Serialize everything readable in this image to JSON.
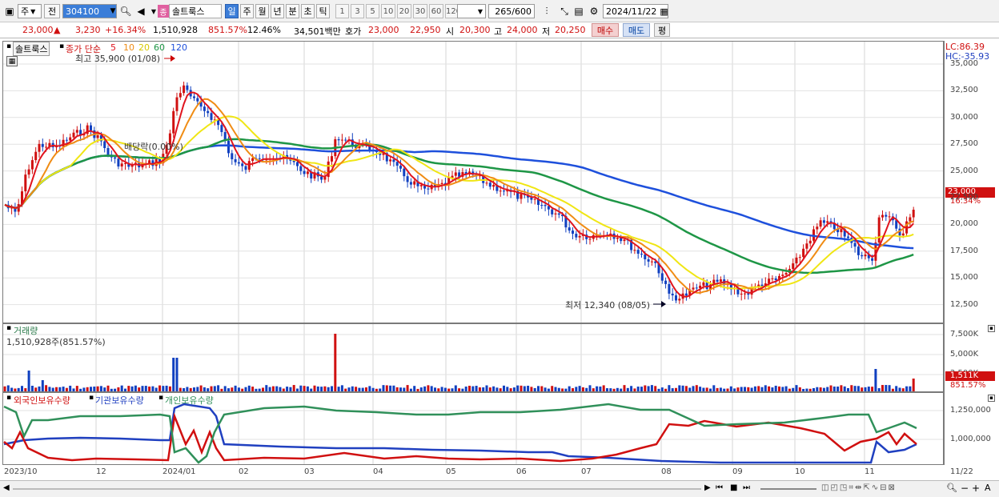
{
  "toolbar": {
    "market": "주",
    "prev": "전",
    "code": "304100",
    "badge": "종",
    "name": "솔트룩스",
    "periods": [
      "일",
      "주",
      "월",
      "년",
      "분",
      "초",
      "틱"
    ],
    "nums": [
      "1",
      "3",
      "5",
      "10",
      "20",
      "30",
      "60",
      "120"
    ],
    "count": "265",
    "count_total": "/600",
    "date": "2024/11/22"
  },
  "quote": {
    "price": "23,000",
    "arrow": "▲",
    "change": "3,230",
    "pct": "+16.34%",
    "volume": "1,510,928",
    "vol_ratio": "851.57%",
    "turnover": "12.46%",
    "amount": "34,501백만",
    "ask_label": "호가",
    "ask": "23,000",
    "bid": "22,950",
    "open_label": "시",
    "open": "20,300",
    "high_label": "고",
    "high": "24,000",
    "low_label": "저",
    "low": "20,250",
    "buy": "매수",
    "sell": "매도",
    "eval": "평"
  },
  "price_panel": {
    "name": "솔트룩스",
    "legend_prefix": "종가 단순",
    "ma": [
      {
        "label": "5",
        "color": "#e0141e"
      },
      {
        "label": "10",
        "color": "#f08c14"
      },
      {
        "label": "20",
        "color": "#f0e614"
      },
      {
        "label": "60",
        "color": "#1e9646"
      },
      {
        "label": "120",
        "color": "#1e50dc"
      }
    ],
    "high_note": "최고 35,900 (01/08)",
    "low_note": "최저 12,340 (08/05)",
    "dividend_note": "배당락(0.00%)",
    "lc": "LC:86.39",
    "hc": "HC:-35.93",
    "last_price": "23,000",
    "last_pct": "16.34%",
    "y_labels": [
      "35,000",
      "32,500",
      "30,000",
      "27,500",
      "25,000",
      "22,500",
      "20,000",
      "17,500",
      "15,000",
      "12,500"
    ]
  },
  "volume_panel": {
    "title": "거래량",
    "value": "1,510,928주(851.57%)",
    "y_labels": [
      "7,500K",
      "5,000K",
      "2,500K"
    ],
    "last": "1,511K",
    "last_pct": "851.57%"
  },
  "holders_panel": {
    "legend": [
      {
        "label": "외국인보유수량",
        "color": "#d01010"
      },
      {
        "label": "기관보유수량",
        "color": "#2040c0"
      },
      {
        "label": "개인보유수량",
        "color": "#30905a"
      }
    ],
    "y_labels": [
      "1,250,000",
      "1,000,000"
    ]
  },
  "x_labels": [
    "2023/10",
    "12",
    "2024/01",
    "02",
    "03",
    "04",
    "05",
    "06",
    "07",
    "08",
    "09",
    "10",
    "11"
  ],
  "x_end_label": "11/22",
  "colors": {
    "up": "#d01010",
    "down": "#1040c0",
    "accent": "#3b7dd8"
  }
}
